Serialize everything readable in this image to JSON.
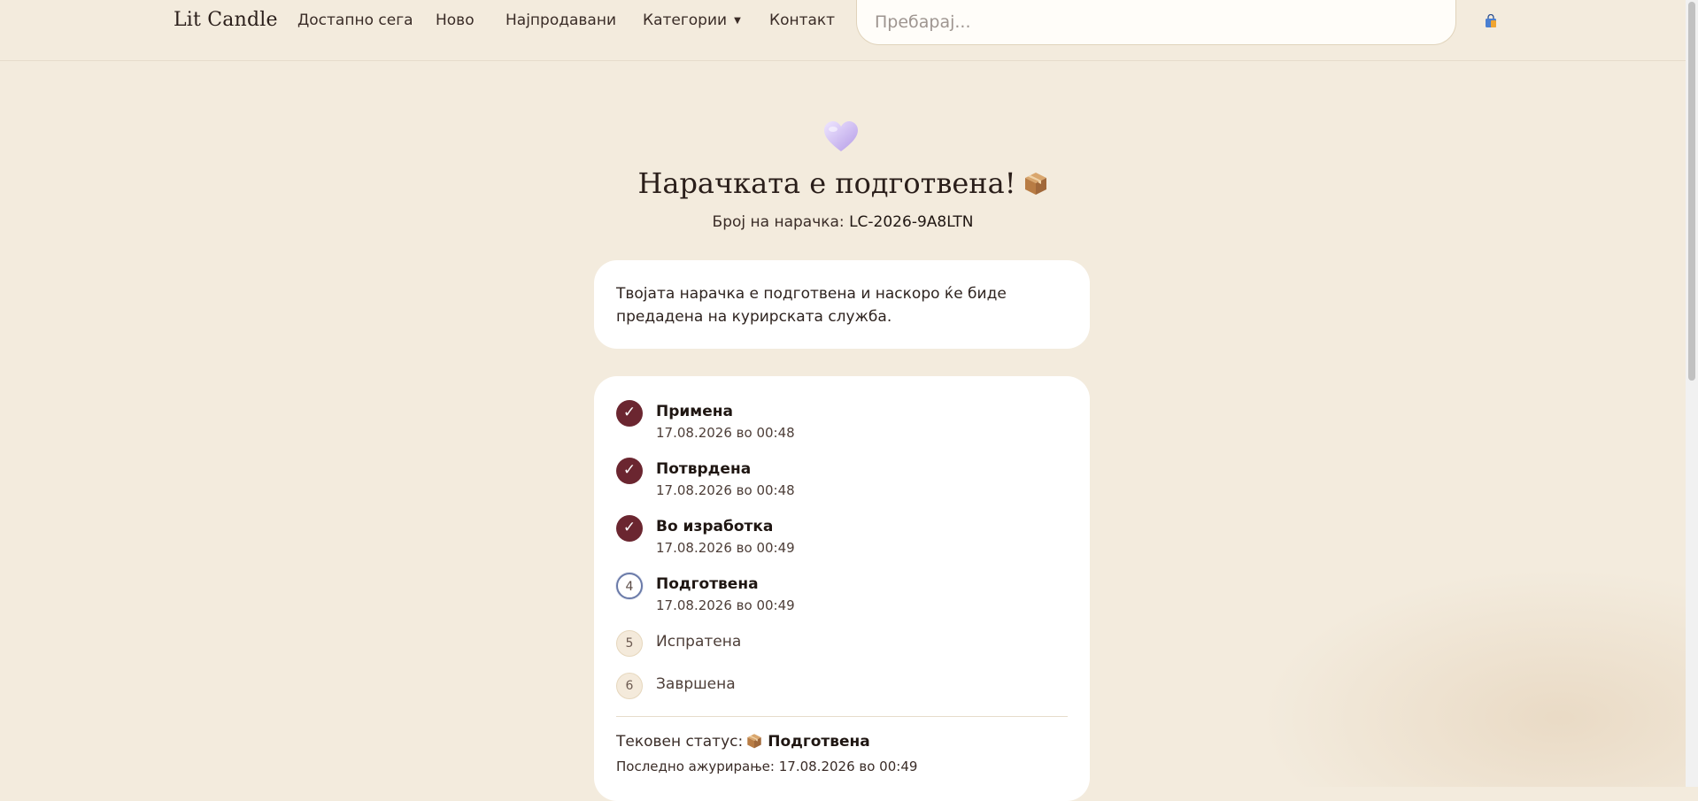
{
  "brand": "Lit Candle",
  "nav": {
    "items": [
      {
        "label": "Достапно сега"
      },
      {
        "label": "Ново"
      },
      {
        "label": "Најпродавани"
      },
      {
        "label": "Категории"
      },
      {
        "label": "Контакт"
      }
    ]
  },
  "search": {
    "placeholder": "Пребарај...",
    "value": ""
  },
  "hero": {
    "icon": "heart-icon",
    "title": "Нарачката е подготвена!",
    "title_icon": "package-icon",
    "order_label": "Број на нарачка:",
    "order_number": "LC-2026-9A8LTN"
  },
  "message": "Твојата нарачка е подготвена и наскоро ќе биде предадена на курирската служба.",
  "steps": [
    {
      "number": "1",
      "label": "Примена",
      "date": "17.08.2026 во 00:48",
      "state": "done"
    },
    {
      "number": "2",
      "label": "Потврдена",
      "date": "17.08.2026 во 00:48",
      "state": "done"
    },
    {
      "number": "3",
      "label": "Во изработка",
      "date": "17.08.2026 во 00:49",
      "state": "done"
    },
    {
      "number": "4",
      "label": "Подготвена",
      "date": "17.08.2026 во 00:49",
      "state": "current"
    },
    {
      "number": "5",
      "label": "Испратена",
      "date": "",
      "state": "pending"
    },
    {
      "number": "6",
      "label": "Завршена",
      "date": "",
      "state": "pending"
    }
  ],
  "done_mark": "✓",
  "status": {
    "label": "Тековен статус:",
    "icon": "package-icon",
    "value": "Подготвена",
    "updated": "Последно ажурирање: 17.08.2026 во 00:49"
  },
  "colors": {
    "background": "#f3ebdd",
    "accent": "#6b2630",
    "current_ring": "#6a7aa8",
    "card": "#ffffff"
  }
}
